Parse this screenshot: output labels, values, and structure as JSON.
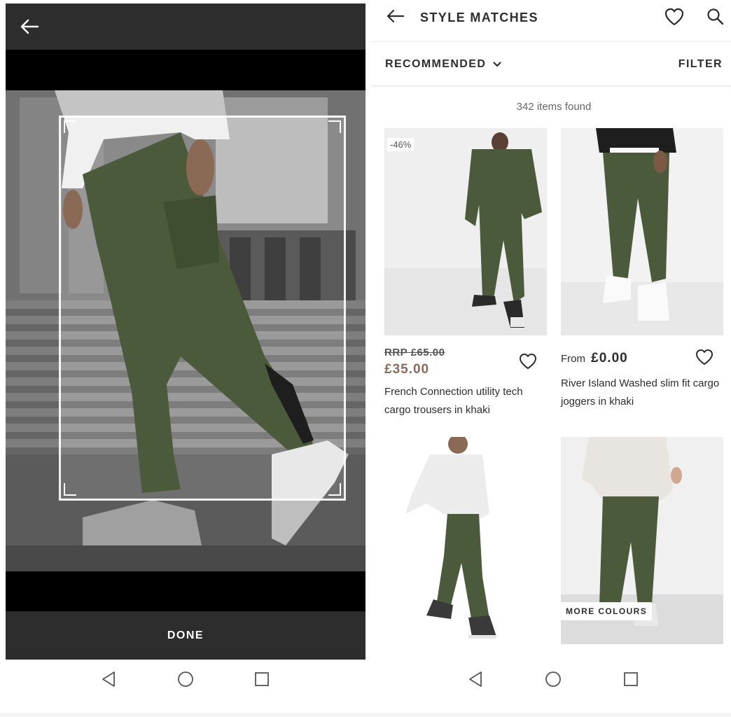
{
  "left_panel": {
    "back_icon": "arrow-left-icon",
    "done_label": "DONE"
  },
  "right_panel": {
    "header": {
      "title": "STYLE MATCHES",
      "back_icon": "arrow-left-icon",
      "saved_icon": "heart-outline-icon",
      "search_icon": "search-icon"
    },
    "sort": {
      "label": "RECOMMENDED",
      "icon": "chevron-down-icon"
    },
    "filter_label": "FILTER",
    "items_found": "342 items found",
    "products": [
      {
        "badge": "-46%",
        "rrp": "RRP £65.00",
        "price": "£35.00",
        "name": "French Connection utility tech cargo trousers in khaki"
      },
      {
        "price_prefix": "From",
        "price": "£0.00",
        "name": "River Island Washed slim fit cargo joggers in khaki"
      },
      {},
      {
        "overlay": "MORE COLOURS"
      }
    ],
    "colors": {
      "text": "#2d2d2d",
      "sale_price": "#8b6b5a",
      "khaki": "#4a5a3a"
    }
  },
  "navbar": {
    "back_icon": "triangle-back-icon",
    "home_icon": "circle-home-icon",
    "recents_icon": "square-recents-icon"
  }
}
